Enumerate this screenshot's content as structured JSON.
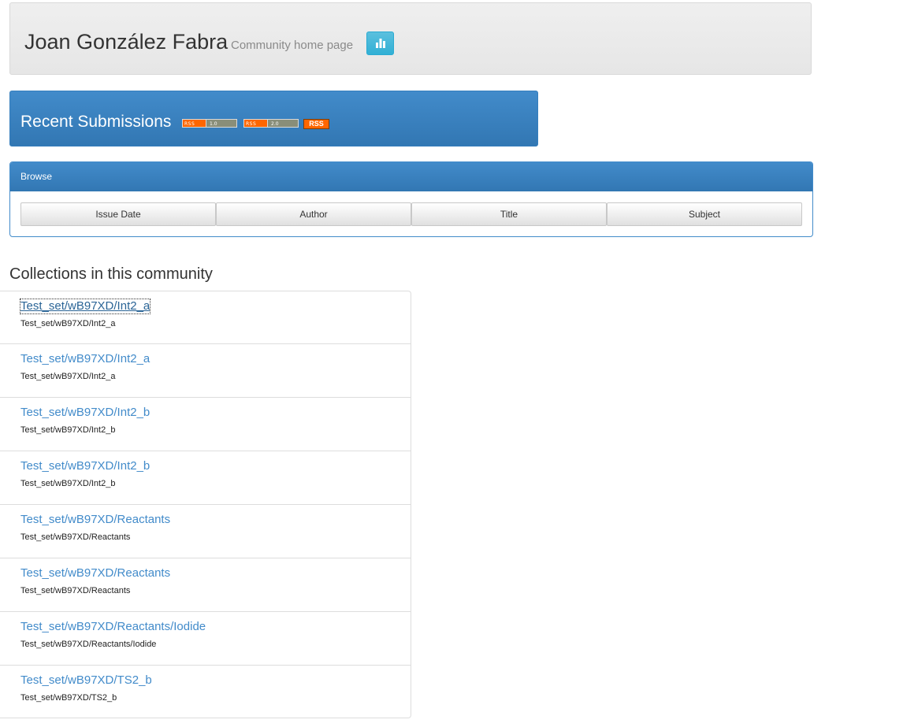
{
  "header": {
    "title": "Joan González Fabra",
    "subtitle": "Community home page",
    "stats_icon": "bar-chart-icon"
  },
  "recent": {
    "title": "Recent Submissions",
    "feeds": [
      {
        "left": "RSS",
        "right": "1.0"
      },
      {
        "left": "RSS",
        "right": "2.0"
      }
    ],
    "rss_label": "RSS"
  },
  "browse": {
    "heading": "Browse",
    "buttons": [
      "Issue Date",
      "Author",
      "Title",
      "Subject"
    ]
  },
  "collections": {
    "title": "Collections in this community",
    "items": [
      {
        "link": "Test_set/wB97XD/Int2_a",
        "desc": "Test_set/wB97XD/Int2_a"
      },
      {
        "link": "Test_set/wB97XD/Int2_a",
        "desc": "Test_set/wB97XD/Int2_a"
      },
      {
        "link": "Test_set/wB97XD/Int2_b",
        "desc": "Test_set/wB97XD/Int2_b"
      },
      {
        "link": "Test_set/wB97XD/Int2_b",
        "desc": "Test_set/wB97XD/Int2_b"
      },
      {
        "link": "Test_set/wB97XD/Reactants",
        "desc": "Test_set/wB97XD/Reactants"
      },
      {
        "link": "Test_set/wB97XD/Reactants",
        "desc": "Test_set/wB97XD/Reactants"
      },
      {
        "link": "Test_set/wB97XD/Reactants/Iodide",
        "desc": "Test_set/wB97XD/Reactants/Iodide"
      },
      {
        "link": "Test_set/wB97XD/TS2_b",
        "desc": "Test_set/wB97XD/TS2_b"
      }
    ]
  }
}
